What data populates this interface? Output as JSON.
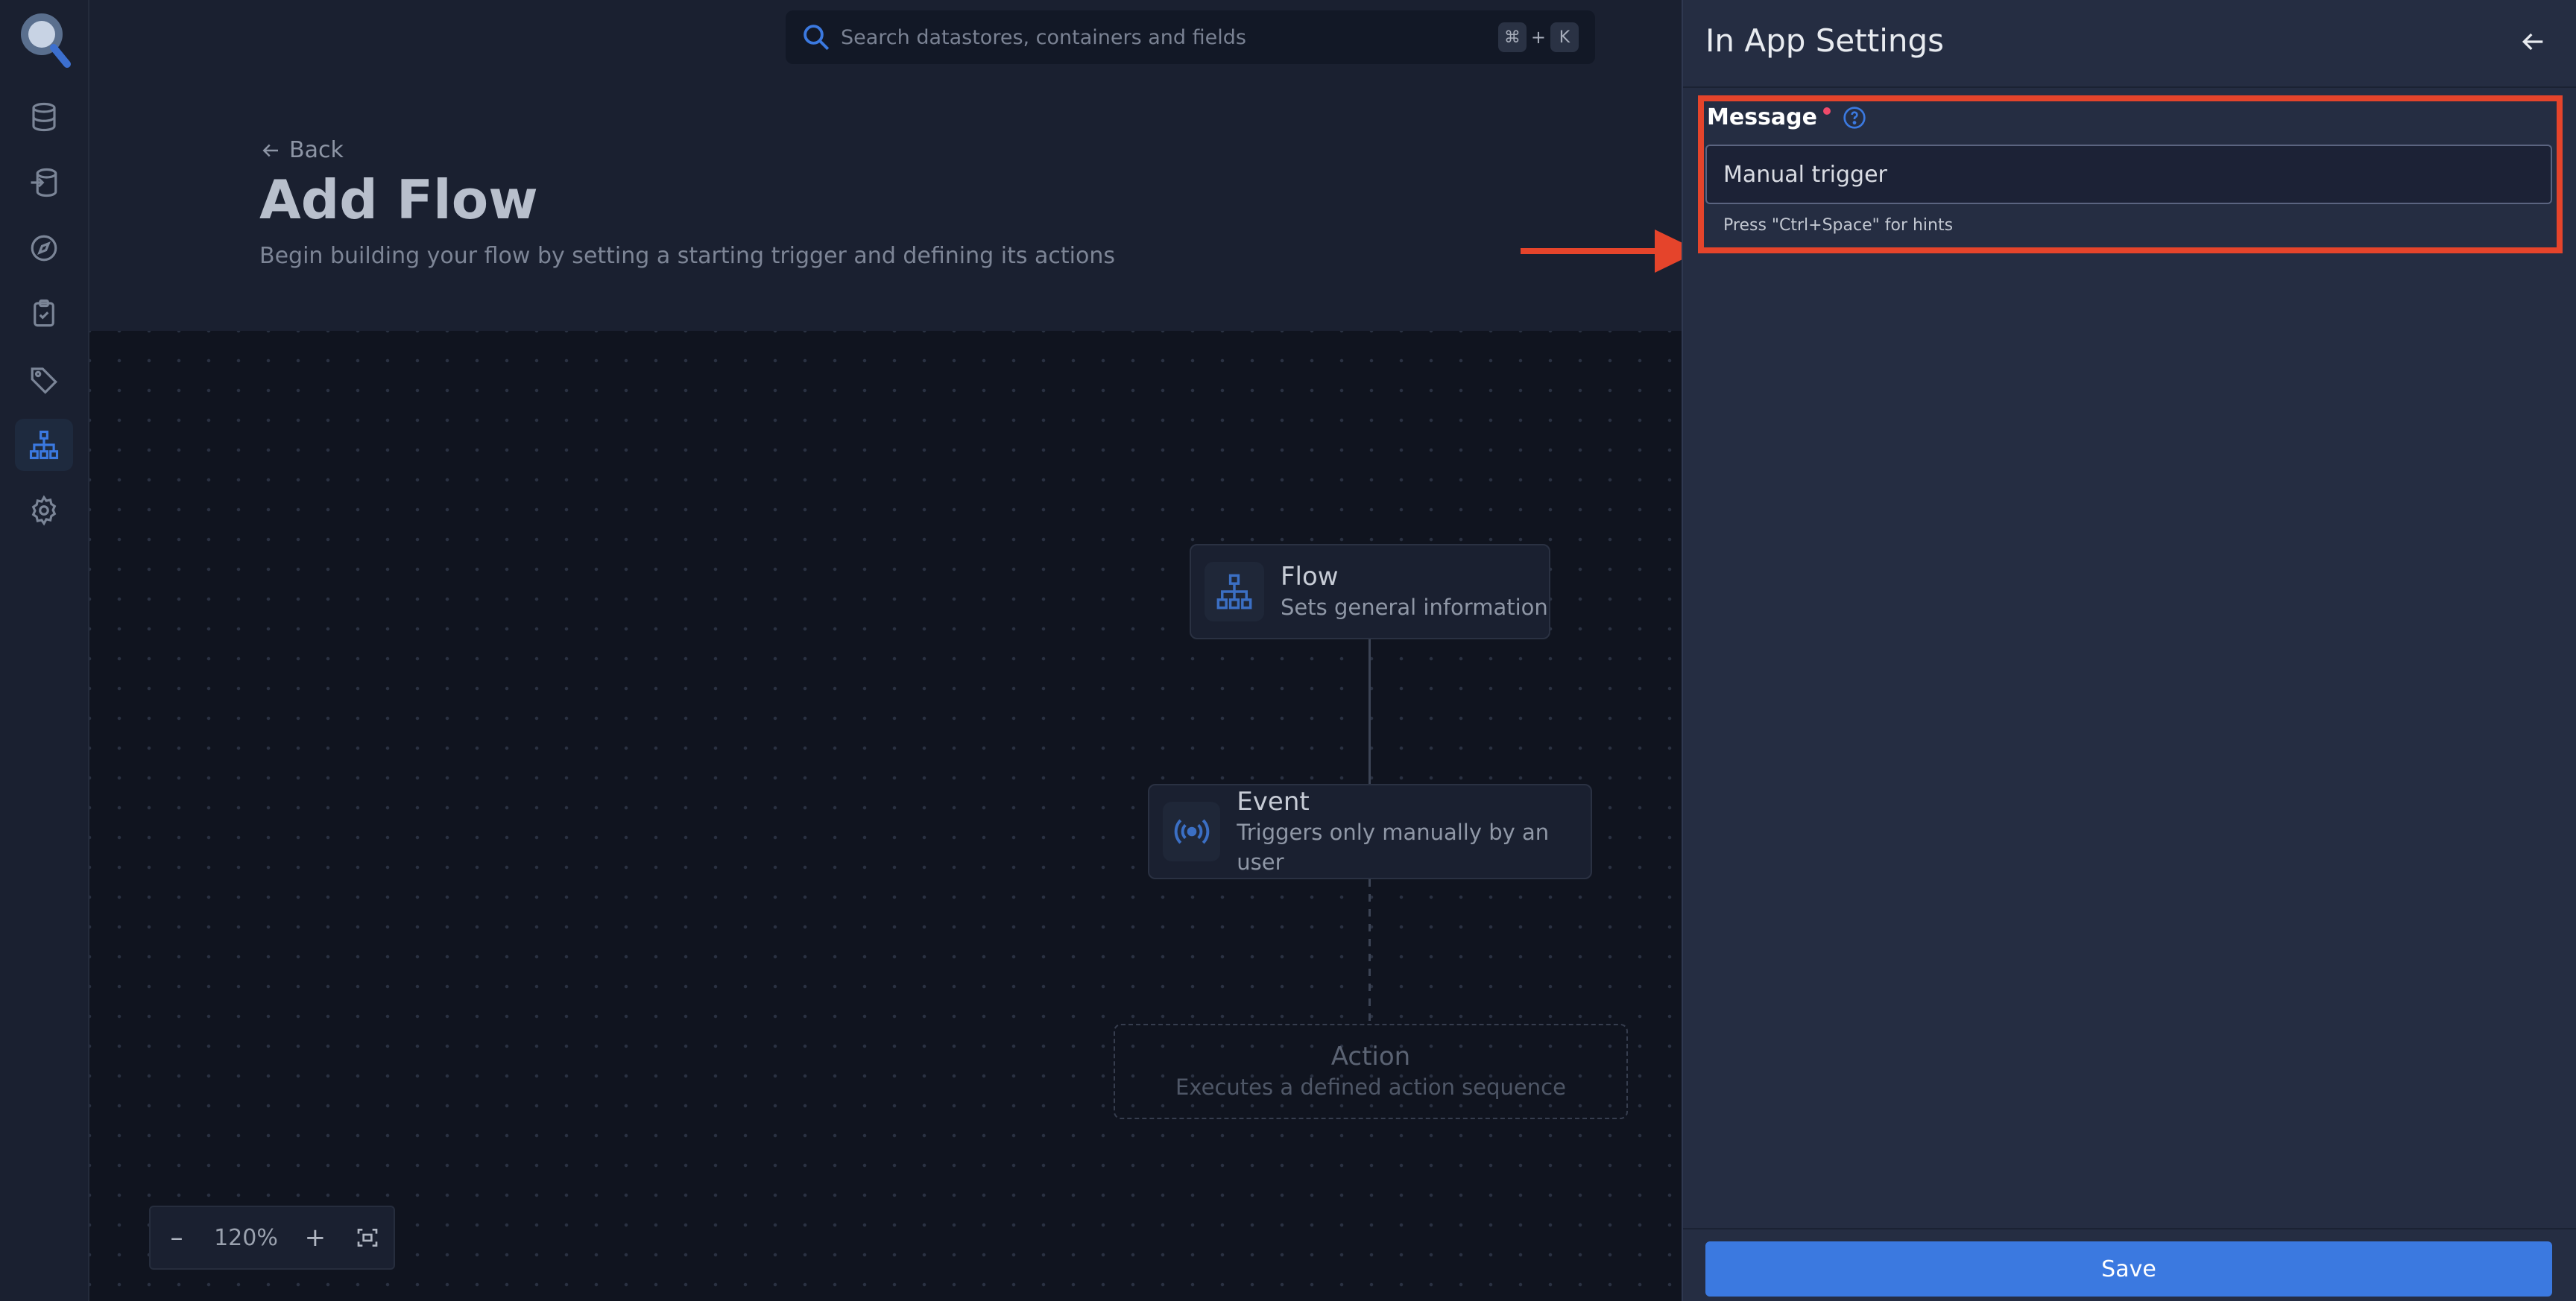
{
  "search": {
    "placeholder": "Search datastores, containers and fields",
    "shortcut_key1": "⌘",
    "shortcut_plus": "+",
    "shortcut_key2": "K"
  },
  "sidebar": {
    "items": [
      {
        "icon": "database-icon"
      },
      {
        "icon": "sources-icon"
      },
      {
        "icon": "compass-icon"
      },
      {
        "icon": "clipboard-check-icon"
      },
      {
        "icon": "tag-icon"
      },
      {
        "icon": "flow-hierarchy-icon",
        "active": true
      },
      {
        "icon": "gear-icon"
      }
    ]
  },
  "header": {
    "back_label": "Back",
    "title": "Add Flow",
    "subtitle": "Begin building your flow by setting a starting trigger and defining its actions"
  },
  "canvas": {
    "nodes": {
      "flow": {
        "title": "Flow",
        "description": "Sets general information"
      },
      "event": {
        "title": "Event",
        "description": "Triggers only manually by an user"
      },
      "action": {
        "title": "Action",
        "description": "Executes a defined action sequence"
      }
    },
    "zoom": {
      "minus": "–",
      "level": "120%",
      "plus": "+"
    }
  },
  "panel": {
    "title": "In App Settings",
    "field_label": "Message",
    "message_value": "Manual trigger",
    "hint": "Press \"Ctrl+Space\" for hints",
    "save_label": "Save"
  },
  "colors": {
    "accent": "#3b79e0",
    "highlight": "#e5442b",
    "required": "#ef4a6a"
  }
}
